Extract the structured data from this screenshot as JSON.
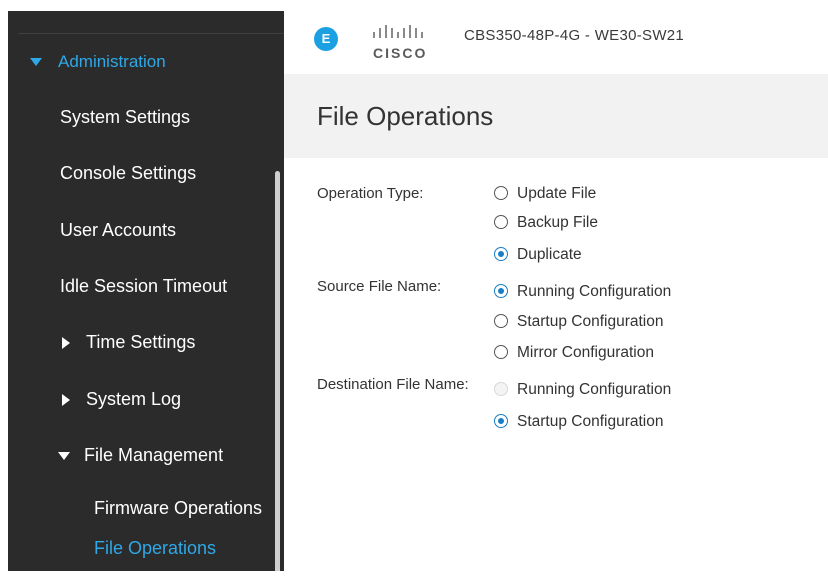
{
  "header": {
    "logo_glyph": "E",
    "brand_word": "CISCO",
    "device_name": "CBS350-48P-4G - WE30-SW21"
  },
  "sidebar": {
    "section": "Administration",
    "items": [
      {
        "label": "System Settings"
      },
      {
        "label": "Console Settings"
      },
      {
        "label": "User Accounts"
      },
      {
        "label": "Idle Session Timeout"
      },
      {
        "label": "Time Settings",
        "expander": "collapsed"
      },
      {
        "label": "System Log",
        "expander": "collapsed"
      },
      {
        "label": "File Management",
        "expander": "expanded"
      }
    ],
    "subitems": [
      {
        "label": "Firmware Operations"
      },
      {
        "label": "File Operations",
        "active": true
      }
    ]
  },
  "page": {
    "title": "File Operations"
  },
  "form": {
    "operation_type": {
      "label": "Operation Type:",
      "options": [
        "Update File",
        "Backup File",
        "Duplicate"
      ],
      "selected": "Duplicate"
    },
    "source_file": {
      "label": "Source File Name:",
      "options": [
        "Running Configuration",
        "Startup Configuration",
        "Mirror Configuration"
      ],
      "selected": "Running Configuration"
    },
    "destination_file": {
      "label": "Destination File Name:",
      "options": [
        "Running Configuration",
        "Startup Configuration"
      ],
      "selected": "Startup Configuration",
      "disabled": [
        "Running Configuration"
      ]
    }
  },
  "colors": {
    "accent": "#2ea8e6",
    "sidebar_bg": "#2b2b2b",
    "radio_selected": "#1a7ec4"
  }
}
